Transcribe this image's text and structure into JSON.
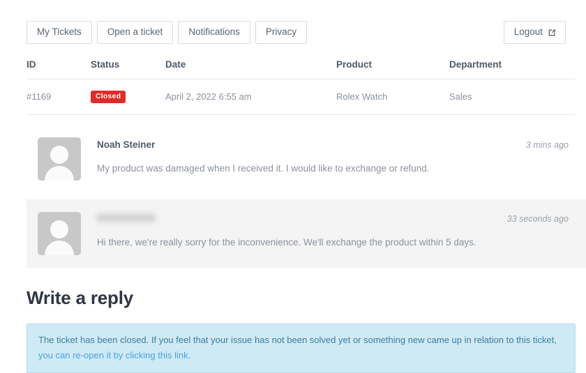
{
  "nav": {
    "items": [
      {
        "label": "My Tickets"
      },
      {
        "label": "Open a ticket"
      },
      {
        "label": "Notifications"
      },
      {
        "label": "Privacy"
      }
    ],
    "logout": {
      "label": "Logout",
      "icon": "external-link-icon"
    }
  },
  "table": {
    "headers": [
      "ID",
      "Status",
      "Date",
      "Product",
      "Department"
    ],
    "rows": [
      {
        "id": "#1169",
        "status": "Closed",
        "status_color": "#e02b27",
        "date": "April 2, 2022 6:55 am",
        "product": "Rolex Watch",
        "department": "Sales"
      }
    ]
  },
  "messages": [
    {
      "author": "Noah Steiner",
      "author_redacted": false,
      "time": "3 mins ago",
      "body": "My product was damaged when I received it. I would like to exchange or refund.",
      "avatar_icon": "user-placeholder-icon",
      "shaded": false
    },
    {
      "author": "",
      "author_redacted": true,
      "time": "33 seconds ago",
      "body": "Hi there, we're really sorry for the inconvenience. We'll exchange the product within 5 days.",
      "avatar_icon": "user-placeholder-icon",
      "shaded": true
    }
  ],
  "reply": {
    "heading": "Write a reply",
    "notice_text": "The ticket has been closed. If you feel that your issue has not been solved yet or something new came up in relation to this ticket, ",
    "notice_link": "you can re-open it by clicking this link.",
    "notice_bg": "#cfe9f5",
    "notice_link_color": "#4aa3df"
  }
}
